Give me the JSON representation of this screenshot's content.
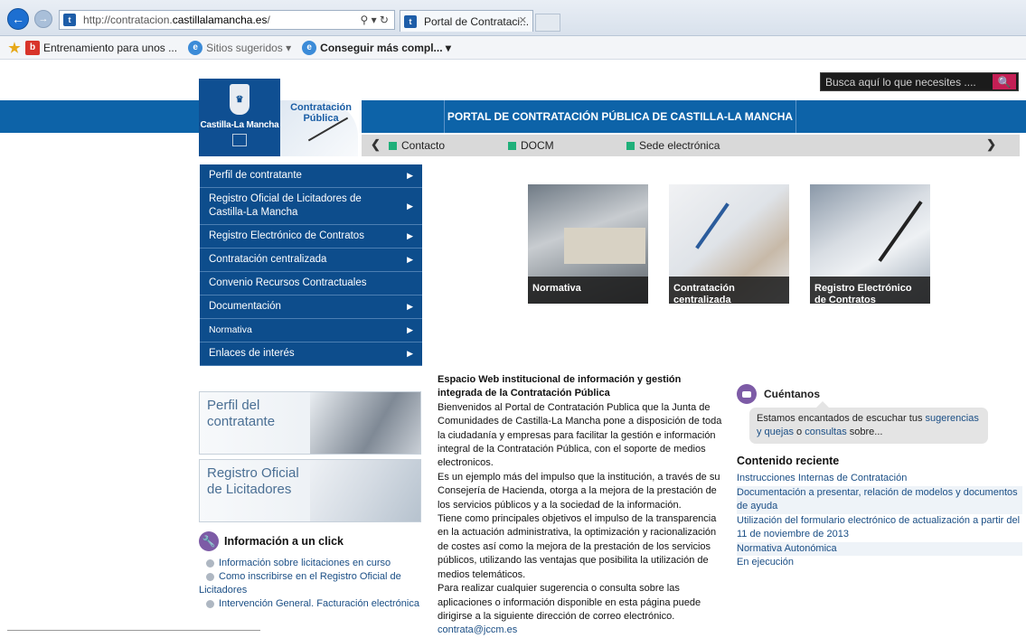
{
  "browser": {
    "url_prefix": "http://contratacion.",
    "url_domain": "castillalamancha.es",
    "url_suffix": "/",
    "address_icons": "⚲ ▾ ↻",
    "tab_title": "Portal de Contrataci...",
    "tab_close": "✕",
    "back_glyph": "←",
    "fwd_glyph": "→",
    "favicon_glyph": "t",
    "favorites": [
      {
        "label": "Entrenamiento para unos ...",
        "icon": "bing-icon"
      },
      {
        "label": "Sitios sugeridos ▾",
        "icon": "ie-icon"
      },
      {
        "label": "Conseguir más compl... ▾",
        "icon": "ie-icon"
      }
    ]
  },
  "search": {
    "placeholder": "Busca aquí lo que necesites ....",
    "button_glyph": "🔍"
  },
  "header": {
    "logo_text": "Castilla-La Mancha",
    "logo_crest": "♛",
    "cp_title_1": "Contratación",
    "cp_title_2": "Pública",
    "portal_title": "PORTAL DE CONTRATACIÓN PÚBLICA DE CASTILLA-LA MANCHA"
  },
  "quick_links": {
    "prev": "❮",
    "next": "❯",
    "items": [
      "Contacto",
      "DOCM",
      "Sede electrónica"
    ]
  },
  "menu": [
    {
      "label": "Perfil de contratante",
      "arrow": "▶"
    },
    {
      "label": "Registro Oficial de Licitadores de Castilla-La Mancha",
      "arrow": "▶"
    },
    {
      "label": "Registro Electrónico de Contratos",
      "arrow": "▶"
    },
    {
      "label": "Contratación centralizada",
      "arrow": "▶"
    },
    {
      "label": "Convenio Recursos Contractuales",
      "arrow": ""
    },
    {
      "label": "Documentación",
      "arrow": "▶"
    },
    {
      "label": "Normativa",
      "arrow": "▶"
    },
    {
      "label": "Enlaces de interés",
      "arrow": "▶"
    }
  ],
  "tiles": [
    {
      "caption": "Normativa"
    },
    {
      "caption": "Contratación centralizada"
    },
    {
      "caption": "Registro Electrónico de Contratos"
    }
  ],
  "banners": {
    "perfil": "Perfil del contratante",
    "registro": "Registro Oficial de Licitadores"
  },
  "info": {
    "title": "Información a un click",
    "icon_glyph": "🔧",
    "items": [
      "Información sobre licitaciones en curso",
      "Como inscribirse en el Registro Oficial de Licitadores",
      "Intervención General. Facturación electrónica"
    ]
  },
  "center": {
    "heading": "Espacio Web institucional de información y gestión integrada de la Contratación Pública",
    "p1": "Bienvenidos al Portal de Contratación Publica que la Junta de Comunidades de Castilla-La Mancha pone a disposición de toda la ciudadanía y empresas para facilitar la gestión e información integral de la Contratación Pública, con el soporte de medios electronicos.",
    "p2": "Es un ejemplo más del impulso que la institución, a través de su Consejería de Hacienda, otorga a la mejora de la prestación de los servicios públicos y a la sociedad de la información.",
    "p3": "Tiene como principales objetivos el impulso de la transparencia en la actuación administrativa, la optimización y racionalización de costes así como la mejora de la prestación de los servicios públicos, utilizando las ventajas que posibilita la utilización de medios telemáticos.",
    "p4": "Para realizar cualquier sugerencia o consulta sobre las aplicaciones o información disponible en esta página puede dirigirse a la siguiente dirección de correo electrónico.",
    "email": "contrata@jccm.es"
  },
  "cuentanos": {
    "title": "Cuéntanos",
    "text_1": "Estamos encantados de escuchar tus ",
    "link_1": "sugerencias y quejas",
    "text_2": " o ",
    "link_2": "consultas",
    "text_3": " sobre..."
  },
  "reciente": {
    "title": "Contenido reciente",
    "items": [
      "Instrucciones Internas de Contratación",
      "Documentación a presentar, relación de modelos y documentos de ayuda",
      "Utilización del formulario electrónico de actualización a partir del 11 de noviembre de 2013",
      "Normativa Autonómica",
      "En ejecución"
    ]
  },
  "colors": {
    "band": "#0d63a8",
    "menu": "#0d4d8c",
    "link": "#1a4e85",
    "accent": "#c41f55",
    "green": "#20b07a"
  }
}
